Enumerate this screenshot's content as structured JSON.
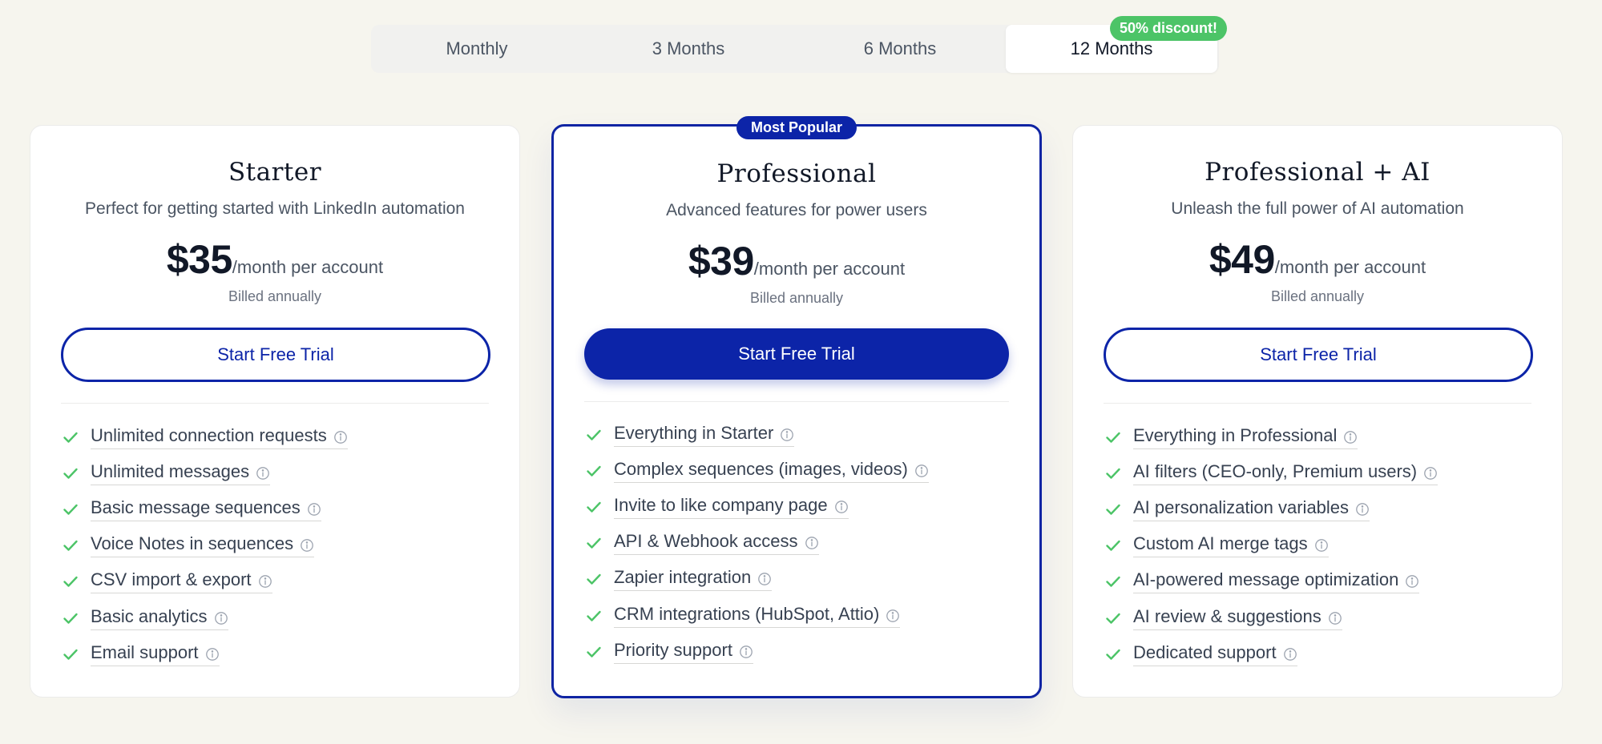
{
  "billing_tabs": [
    {
      "label": "Monthly"
    },
    {
      "label": "3 Months"
    },
    {
      "label": "6 Months"
    },
    {
      "label": "12 Months",
      "active": true,
      "badge": "50% discount!"
    }
  ],
  "colors": {
    "brand": "#0c24a8",
    "discount": "#4cc467",
    "check": "#4cc467",
    "background": "#f6f5ee"
  },
  "icons": {
    "feature_check": "check-icon",
    "feature_info": "info-icon"
  },
  "plans": [
    {
      "name": "Starter",
      "description": "Perfect for getting started with LinkedIn automation",
      "price": "$35",
      "period": "/month per account",
      "billing": "Billed annually",
      "cta": "Start Free Trial",
      "features": [
        "Unlimited connection requests",
        "Unlimited messages",
        "Basic message sequences",
        "Voice Notes in sequences",
        "CSV import & export",
        "Basic analytics",
        "Email support"
      ]
    },
    {
      "name": "Professional",
      "badge": "Most Popular",
      "description": "Advanced features for power users",
      "price": "$39",
      "period": "/month per account",
      "billing": "Billed annually",
      "cta": "Start Free Trial",
      "features": [
        "Everything in Starter",
        "Complex sequences (images, videos)",
        "Invite to like company page",
        "API & Webhook access",
        "Zapier integration",
        "CRM integrations (HubSpot, Attio)",
        "Priority support"
      ]
    },
    {
      "name": "Professional + AI",
      "description": "Unleash the full power of AI automation",
      "price": "$49",
      "period": "/month per account",
      "billing": "Billed annually",
      "cta": "Start Free Trial",
      "features": [
        "Everything in Professional",
        "AI filters (CEO-only, Premium users)",
        "AI personalization variables",
        "Custom AI merge tags",
        "AI-powered message optimization",
        "AI review & suggestions",
        "Dedicated support"
      ]
    }
  ]
}
